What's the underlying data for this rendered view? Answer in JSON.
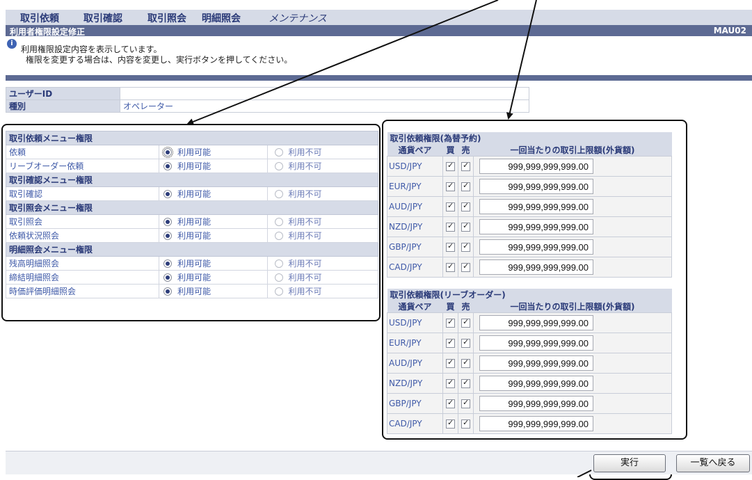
{
  "tabs": [
    "取引依頼",
    "取引確認",
    "取引照会",
    "明細照会",
    "メンテナンス"
  ],
  "title": "利用者権限設定修正",
  "screen_code": "MAU02",
  "message": [
    "利用権限設定内容を表示しています。",
    "権限を変更する場合は、内容を変更し、実行ボタンを押してください。"
  ],
  "user": {
    "id_label": "ユーザーID",
    "id_value": "",
    "type_label": "種別",
    "type_value": "オペレーター"
  },
  "menu_permissions": {
    "sections": [
      {
        "header": "取引依頼メニュー権限",
        "items": [
          {
            "name": "依頼",
            "allowed": true
          },
          {
            "name": "リーブオーダー依頼",
            "allowed": true
          }
        ]
      },
      {
        "header": "取引確認メニュー権限",
        "items": [
          {
            "name": "取引確認",
            "allowed": true
          }
        ]
      },
      {
        "header": "取引照会メニュー権限",
        "items": [
          {
            "name": "取引照会",
            "allowed": true
          },
          {
            "name": "依頼状況照会",
            "allowed": true
          }
        ]
      },
      {
        "header": "明細照会メニュー権限",
        "items": [
          {
            "name": "残高明細照会",
            "allowed": true
          },
          {
            "name": "締結明細照会",
            "allowed": true
          },
          {
            "name": "時価評価明細照会",
            "allowed": true
          }
        ]
      }
    ],
    "allow_label": "利用可能",
    "deny_label": "利用不可"
  },
  "currency_columns": {
    "pair": "通貨ペア",
    "buy": "買",
    "sell": "売",
    "limit": "一回当たりの取引上限額(外貨額)"
  },
  "currency_tables": [
    {
      "title": "取引依頼権限(為替予約)",
      "rows": [
        {
          "pair": "USD/JPY",
          "buy": true,
          "sell": true,
          "limit": "999,999,999,999.00"
        },
        {
          "pair": "EUR/JPY",
          "buy": true,
          "sell": true,
          "limit": "999,999,999,999.00"
        },
        {
          "pair": "AUD/JPY",
          "buy": true,
          "sell": true,
          "limit": "999,999,999,999.00"
        },
        {
          "pair": "NZD/JPY",
          "buy": true,
          "sell": true,
          "limit": "999,999,999,999.00"
        },
        {
          "pair": "GBP/JPY",
          "buy": true,
          "sell": true,
          "limit": "999,999,999,999.00"
        },
        {
          "pair": "CAD/JPY",
          "buy": true,
          "sell": true,
          "limit": "999,999,999,999.00"
        }
      ]
    },
    {
      "title": "取引依頼権限(リーブオーダー)",
      "rows": [
        {
          "pair": "USD/JPY",
          "buy": true,
          "sell": true,
          "limit": "999,999,999,999.00"
        },
        {
          "pair": "EUR/JPY",
          "buy": true,
          "sell": true,
          "limit": "999,999,999,999.00"
        },
        {
          "pair": "AUD/JPY",
          "buy": true,
          "sell": true,
          "limit": "999,999,999,999.00"
        },
        {
          "pair": "NZD/JPY",
          "buy": true,
          "sell": true,
          "limit": "999,999,999,999.00"
        },
        {
          "pair": "GBP/JPY",
          "buy": true,
          "sell": true,
          "limit": "999,999,999,999.00"
        },
        {
          "pair": "CAD/JPY",
          "buy": true,
          "sell": true,
          "limit": "999,999,999,999.00"
        }
      ]
    }
  ],
  "buttons": {
    "execute": "実行",
    "back": "一覧へ戻る"
  }
}
